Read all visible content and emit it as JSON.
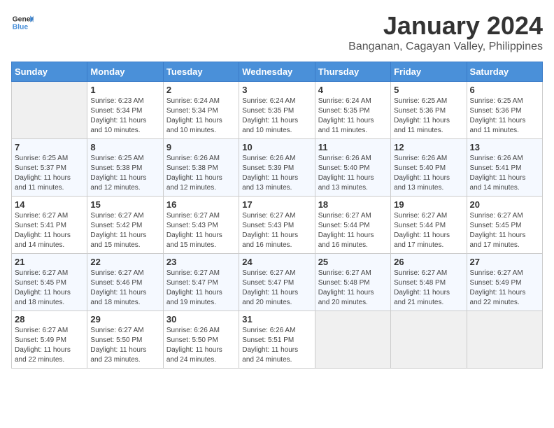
{
  "header": {
    "logo_general": "General",
    "logo_blue": "Blue",
    "title": "January 2024",
    "subtitle": "Banganan, Cagayan Valley, Philippines"
  },
  "days_of_week": [
    "Sunday",
    "Monday",
    "Tuesday",
    "Wednesday",
    "Thursday",
    "Friday",
    "Saturday"
  ],
  "weeks": [
    [
      {
        "day": "",
        "info": ""
      },
      {
        "day": "1",
        "info": "Sunrise: 6:23 AM\nSunset: 5:34 PM\nDaylight: 11 hours\nand 10 minutes."
      },
      {
        "day": "2",
        "info": "Sunrise: 6:24 AM\nSunset: 5:34 PM\nDaylight: 11 hours\nand 10 minutes."
      },
      {
        "day": "3",
        "info": "Sunrise: 6:24 AM\nSunset: 5:35 PM\nDaylight: 11 hours\nand 10 minutes."
      },
      {
        "day": "4",
        "info": "Sunrise: 6:24 AM\nSunset: 5:35 PM\nDaylight: 11 hours\nand 11 minutes."
      },
      {
        "day": "5",
        "info": "Sunrise: 6:25 AM\nSunset: 5:36 PM\nDaylight: 11 hours\nand 11 minutes."
      },
      {
        "day": "6",
        "info": "Sunrise: 6:25 AM\nSunset: 5:36 PM\nDaylight: 11 hours\nand 11 minutes."
      }
    ],
    [
      {
        "day": "7",
        "info": "Sunrise: 6:25 AM\nSunset: 5:37 PM\nDaylight: 11 hours\nand 11 minutes."
      },
      {
        "day": "8",
        "info": "Sunrise: 6:25 AM\nSunset: 5:38 PM\nDaylight: 11 hours\nand 12 minutes."
      },
      {
        "day": "9",
        "info": "Sunrise: 6:26 AM\nSunset: 5:38 PM\nDaylight: 11 hours\nand 12 minutes."
      },
      {
        "day": "10",
        "info": "Sunrise: 6:26 AM\nSunset: 5:39 PM\nDaylight: 11 hours\nand 13 minutes."
      },
      {
        "day": "11",
        "info": "Sunrise: 6:26 AM\nSunset: 5:40 PM\nDaylight: 11 hours\nand 13 minutes."
      },
      {
        "day": "12",
        "info": "Sunrise: 6:26 AM\nSunset: 5:40 PM\nDaylight: 11 hours\nand 13 minutes."
      },
      {
        "day": "13",
        "info": "Sunrise: 6:26 AM\nSunset: 5:41 PM\nDaylight: 11 hours\nand 14 minutes."
      }
    ],
    [
      {
        "day": "14",
        "info": "Sunrise: 6:27 AM\nSunset: 5:41 PM\nDaylight: 11 hours\nand 14 minutes."
      },
      {
        "day": "15",
        "info": "Sunrise: 6:27 AM\nSunset: 5:42 PM\nDaylight: 11 hours\nand 15 minutes."
      },
      {
        "day": "16",
        "info": "Sunrise: 6:27 AM\nSunset: 5:43 PM\nDaylight: 11 hours\nand 15 minutes."
      },
      {
        "day": "17",
        "info": "Sunrise: 6:27 AM\nSunset: 5:43 PM\nDaylight: 11 hours\nand 16 minutes."
      },
      {
        "day": "18",
        "info": "Sunrise: 6:27 AM\nSunset: 5:44 PM\nDaylight: 11 hours\nand 16 minutes."
      },
      {
        "day": "19",
        "info": "Sunrise: 6:27 AM\nSunset: 5:44 PM\nDaylight: 11 hours\nand 17 minutes."
      },
      {
        "day": "20",
        "info": "Sunrise: 6:27 AM\nSunset: 5:45 PM\nDaylight: 11 hours\nand 17 minutes."
      }
    ],
    [
      {
        "day": "21",
        "info": "Sunrise: 6:27 AM\nSunset: 5:45 PM\nDaylight: 11 hours\nand 18 minutes."
      },
      {
        "day": "22",
        "info": "Sunrise: 6:27 AM\nSunset: 5:46 PM\nDaylight: 11 hours\nand 18 minutes."
      },
      {
        "day": "23",
        "info": "Sunrise: 6:27 AM\nSunset: 5:47 PM\nDaylight: 11 hours\nand 19 minutes."
      },
      {
        "day": "24",
        "info": "Sunrise: 6:27 AM\nSunset: 5:47 PM\nDaylight: 11 hours\nand 20 minutes."
      },
      {
        "day": "25",
        "info": "Sunrise: 6:27 AM\nSunset: 5:48 PM\nDaylight: 11 hours\nand 20 minutes."
      },
      {
        "day": "26",
        "info": "Sunrise: 6:27 AM\nSunset: 5:48 PM\nDaylight: 11 hours\nand 21 minutes."
      },
      {
        "day": "27",
        "info": "Sunrise: 6:27 AM\nSunset: 5:49 PM\nDaylight: 11 hours\nand 22 minutes."
      }
    ],
    [
      {
        "day": "28",
        "info": "Sunrise: 6:27 AM\nSunset: 5:49 PM\nDaylight: 11 hours\nand 22 minutes."
      },
      {
        "day": "29",
        "info": "Sunrise: 6:27 AM\nSunset: 5:50 PM\nDaylight: 11 hours\nand 23 minutes."
      },
      {
        "day": "30",
        "info": "Sunrise: 6:26 AM\nSunset: 5:50 PM\nDaylight: 11 hours\nand 24 minutes."
      },
      {
        "day": "31",
        "info": "Sunrise: 6:26 AM\nSunset: 5:51 PM\nDaylight: 11 hours\nand 24 minutes."
      },
      {
        "day": "",
        "info": ""
      },
      {
        "day": "",
        "info": ""
      },
      {
        "day": "",
        "info": ""
      }
    ]
  ]
}
